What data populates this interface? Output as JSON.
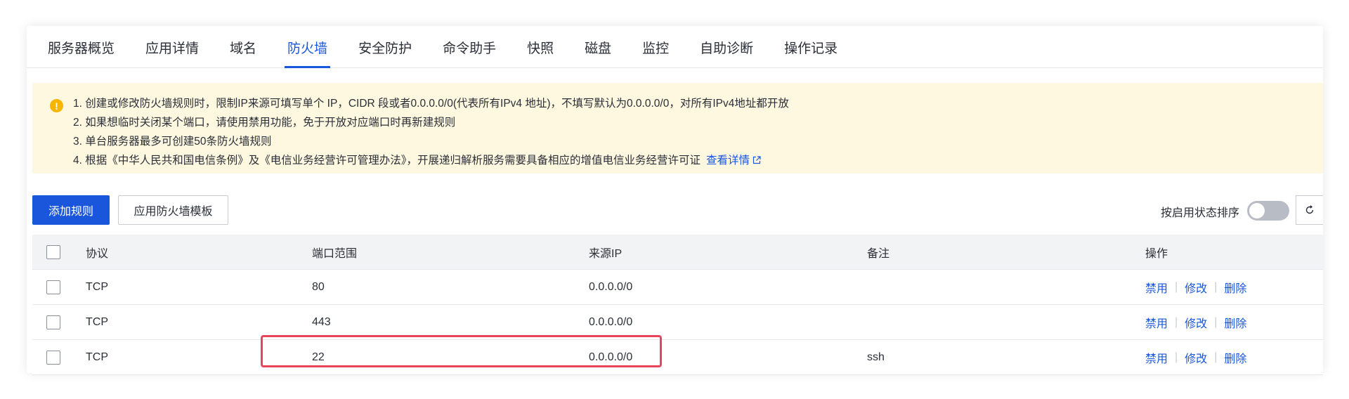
{
  "tabs": [
    {
      "label": "服务器概览"
    },
    {
      "label": "应用详情"
    },
    {
      "label": "域名"
    },
    {
      "label": "防火墙",
      "active": true
    },
    {
      "label": "安全防护"
    },
    {
      "label": "命令助手"
    },
    {
      "label": "快照"
    },
    {
      "label": "磁盘"
    },
    {
      "label": "监控"
    },
    {
      "label": "自助诊断"
    },
    {
      "label": "操作记录"
    }
  ],
  "notice": {
    "icon": "warning-icon",
    "lines": [
      "1. 创建或修改防火墙规则时，限制IP来源可填写单个 IP，CIDR 段或者0.0.0.0/0(代表所有IPv4 地址)，不填写默认为0.0.0.0/0，对所有IPv4地址都开放",
      "2. 如果想临时关闭某个端口，请使用禁用功能，免于开放对应端口时再新建规则",
      "3. 单台服务器最多可创建50条防火墙规则",
      "4. 根据《中华人民共和国电信条例》及《电信业务经营许可管理办法》，开展递归解析服务需要具备相应的增值电信业务经营许可证"
    ],
    "link_label": "查看详情"
  },
  "toolbar": {
    "add_label": "添加规则",
    "template_label": "应用防火墙模板",
    "sort_label": "按启用状态排序",
    "sort_enabled": false
  },
  "table": {
    "headers": {
      "protocol": "协议",
      "port": "端口范围",
      "source": "来源IP",
      "note": "备注",
      "ops": "操作"
    },
    "rows": [
      {
        "protocol": "TCP",
        "port": "80",
        "source": "0.0.0.0/0",
        "note": ""
      },
      {
        "protocol": "TCP",
        "port": "443",
        "source": "0.0.0.0/0",
        "note": ""
      },
      {
        "protocol": "TCP",
        "port": "22",
        "source": "0.0.0.0/0",
        "note": "ssh"
      }
    ],
    "op_labels": {
      "disable": "禁用",
      "edit": "修改",
      "delete": "删除"
    }
  },
  "colors": {
    "accent": "#1a56db",
    "notice_bg": "#fff8e1",
    "highlight": "#e8455a"
  }
}
